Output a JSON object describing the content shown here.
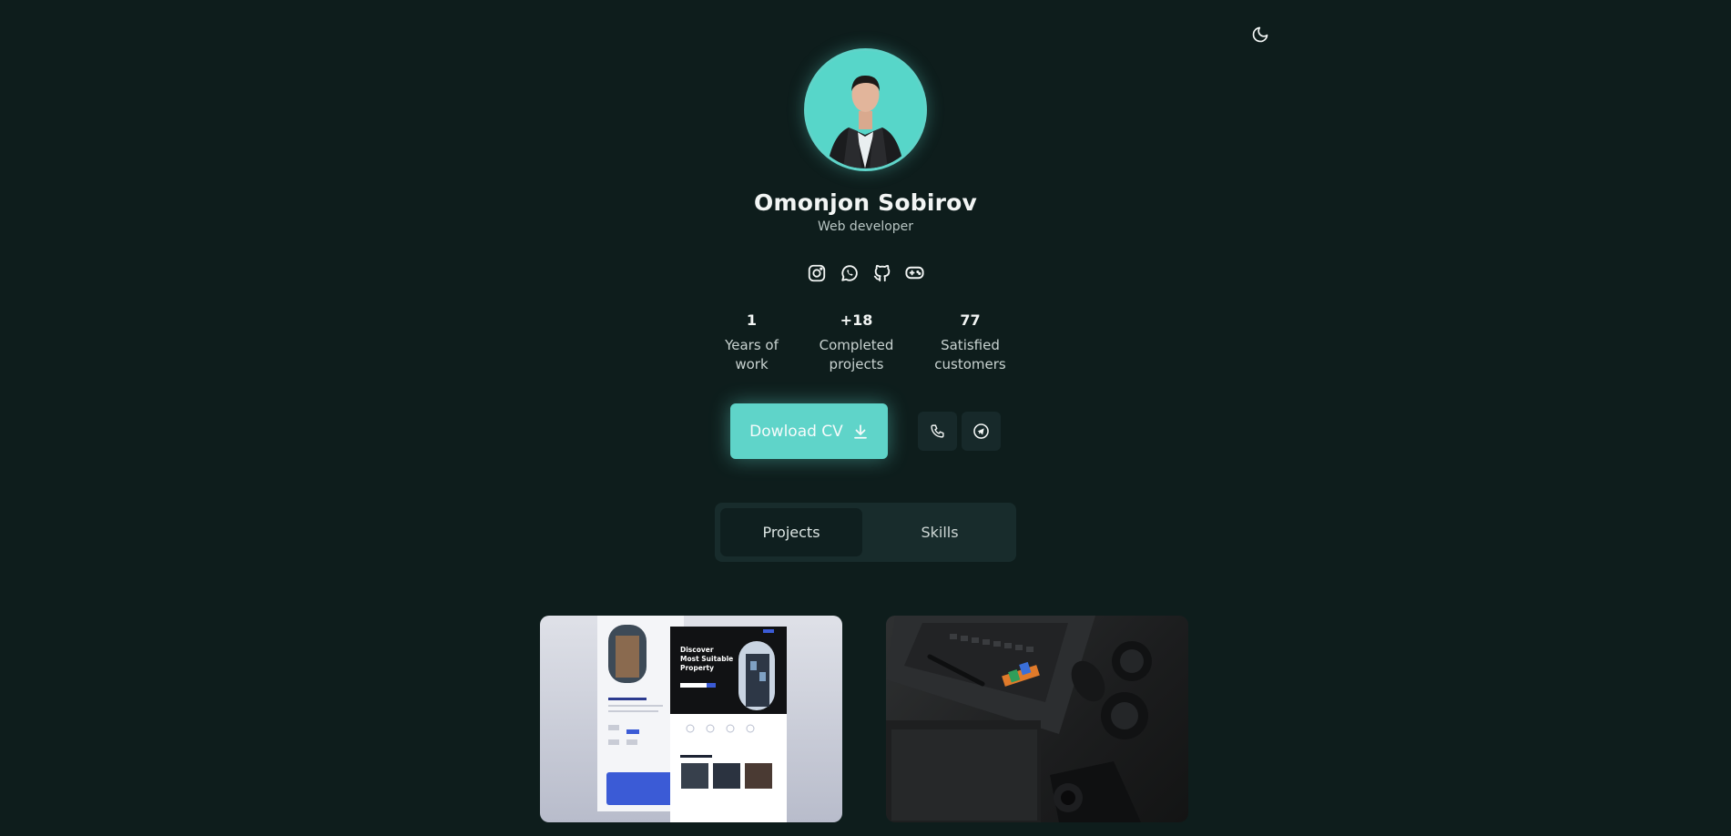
{
  "profile": {
    "name": "Omonjon Sobirov",
    "role": "Web developer"
  },
  "socials": [
    {
      "icon": "instagram-icon"
    },
    {
      "icon": "whatsapp-icon"
    },
    {
      "icon": "github-icon"
    },
    {
      "icon": "gamepad-icon"
    }
  ],
  "stats": [
    {
      "value": "1",
      "label_line1": "Years of",
      "label_line2": "work"
    },
    {
      "value": "+18",
      "label_line1": "Completed",
      "label_line2": "projects"
    },
    {
      "value": "77",
      "label_line1": "Satisfied",
      "label_line2": "customers"
    }
  ],
  "actions": {
    "cv_label": "Dowload CV",
    "cv_icon": "download-icon",
    "phone_icon": "phone-icon",
    "telegram_icon": "telegram-icon"
  },
  "tabs": [
    {
      "label": "Projects",
      "active": true
    },
    {
      "label": "Skills",
      "active": false
    }
  ],
  "mockup": {
    "headline_line1": "Discover",
    "headline_line2": "Most Suitable",
    "headline_line3": "Property"
  },
  "colors": {
    "background": "#0e1d1c",
    "accent": "#5fd4c9",
    "tab_bar": "#182c2c",
    "button_dark": "#17292a"
  }
}
